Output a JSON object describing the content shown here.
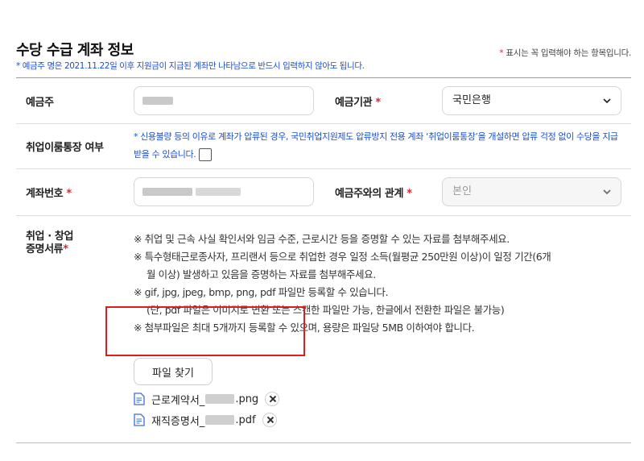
{
  "header": {
    "title": "수당 수급 계좌 정보",
    "subnote": "* 예금주 명은 2021.11.22일 이후 지원금이 지급된 계좌만 나타남으로 반드시 입력하지 않아도 됩니다.",
    "required_star": "*",
    "required_text": "표시는 꼭 입력해야 하는 항목입니다."
  },
  "rows": {
    "holder": {
      "label": "예금주",
      "bank_label": "예금기관",
      "bank_value": "국민은행"
    },
    "protect": {
      "label": "취업이룸통장 여부",
      "info": "* 신용불량 등의 이유로 계좌가 압류된 경우, 국민취업지원제도 압류방지 전용 계좌 ‘취업이룸통장’을 개설하면 압류 걱정 없이 수당을 지급받을 수 있습니다."
    },
    "account": {
      "label": "계좌번호",
      "relation_label": "예금주와의 관계",
      "relation_value": "본인"
    },
    "proof": {
      "label_line1": "취업 · 창업",
      "label_line2": "증명서류",
      "notes": [
        "※ 취업 및 근속 사실 확인서와 임금 수준, 근로시간 등을 증명할 수 있는 자료를 첨부해주세요.",
        "※ 특수형태근로종사자, 프리랜서 등으로 취업한 경우 일정 소득(월평균 250만원 이상)이 일정 기간(6개",
        "월 이상) 발생하고 있음을 증명하는 자료를 첨부해주세요.",
        "※ gif, jpg, jpeg, bmp, png, pdf 파일만 등록할 수 있습니다.",
        "(단, pdf 파일은 이미지로 변환 또는 스캔한 파일만 가능, 한글에서 전환한 파일은 불가능)",
        "※ 첨부파일은 최대 5개까지 등록할 수 있으며, 용량은 파일당 5MB 이하여야 합니다."
      ],
      "file_button": "파일 찾기",
      "files": [
        {
          "prefix": "근로계약서_",
          "ext": ".png"
        },
        {
          "prefix": "재직증명서_",
          "ext": ".pdf"
        }
      ]
    }
  },
  "colors": {
    "accent_blue": "#1a4fd6",
    "required_red": "#e0262d",
    "highlight_red": "#e01b1b"
  }
}
